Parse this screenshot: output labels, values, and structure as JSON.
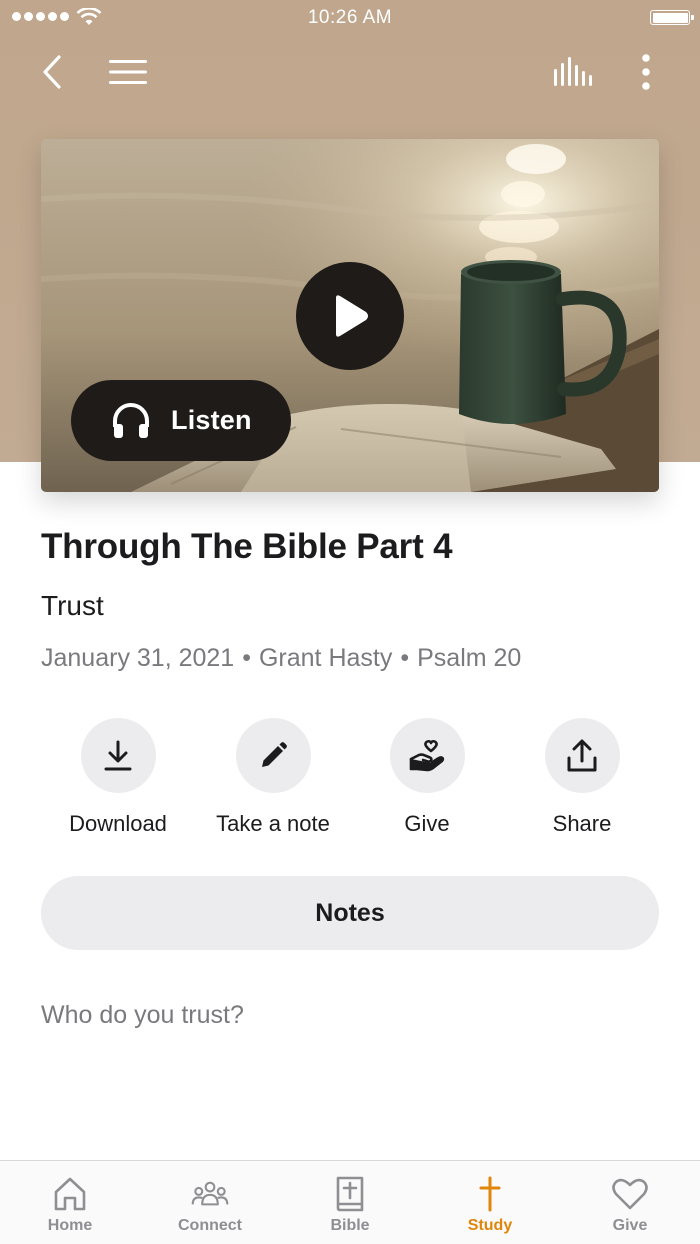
{
  "status_bar": {
    "time": "10:26 AM"
  },
  "nav": {
    "back": "back-icon",
    "menu": "menu-icon",
    "stats": "audio-bars-icon",
    "more": "more-vertical-icon"
  },
  "media": {
    "listen_label": "Listen",
    "play_icon": "play-icon",
    "headphones_icon": "headphones-icon"
  },
  "sermon": {
    "title": "Through The Bible Part 4",
    "subtitle": "Trust",
    "date": "January 31, 2021",
    "speaker": "Grant Hasty",
    "passage": "Psalm 20",
    "separator": "•"
  },
  "actions": [
    {
      "label": "Download",
      "icon": "download-icon"
    },
    {
      "label": "Take a note",
      "icon": "pencil-icon"
    },
    {
      "label": "Give",
      "icon": "hand-heart-icon"
    },
    {
      "label": "Share",
      "icon": "share-icon"
    }
  ],
  "notes": {
    "button_label": "Notes",
    "prompt": "Who do you trust?"
  },
  "tab_bar": {
    "items": [
      {
        "label": "Home",
        "icon": "home-icon"
      },
      {
        "label": "Connect",
        "icon": "people-icon"
      },
      {
        "label": "Bible",
        "icon": "bible-icon"
      },
      {
        "label": "Study",
        "icon": "cross-icon",
        "active": true
      },
      {
        "label": "Give",
        "icon": "heart-icon"
      }
    ]
  },
  "colors": {
    "accent": "#e0860b",
    "hero": "#c2ab93",
    "dark_button": "#1f1b18",
    "muted_text": "#7a7a7e",
    "pill_bg": "#ececee"
  }
}
